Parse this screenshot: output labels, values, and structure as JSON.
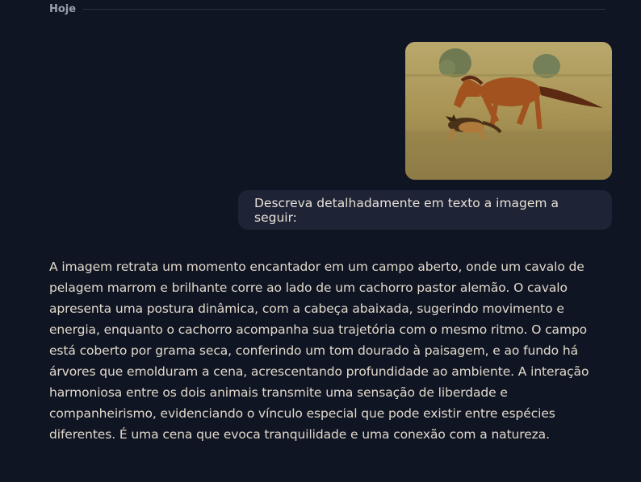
{
  "date_divider": {
    "label": "Hoje"
  },
  "user_message": {
    "text": "Descreva detalhadamente em texto a imagem a seguir:"
  },
  "assistant_message": {
    "text": "A imagem retrata um momento encantador em um campo aberto, onde um cavalo de pelagem marrom e brilhante corre ao lado de um cachorro pastor alemão. O cavalo apresenta uma postura dinâmica, com a cabeça abaixada, sugerindo movimento e energia, enquanto o cachorro acompanha sua trajetória com o mesmo ritmo. O campo está coberto por grama seca, conferindo um tom dourado à paisagem, e ao fundo há árvores que emolduram a cena, acrescentando profundidade ao ambiente. A interação harmoniosa entre os dois animais transmite uma sensação de liberdade e companheirismo, evidenciando o vínculo especial que pode existir entre espécies diferentes. É uma cena que evoca tranquilidade e uma conexão com a natureza."
  },
  "colors": {
    "background": "#0f1522",
    "bubble": "#1e2436",
    "text": "#e8e0d6",
    "muted": "#9aa0ad"
  }
}
